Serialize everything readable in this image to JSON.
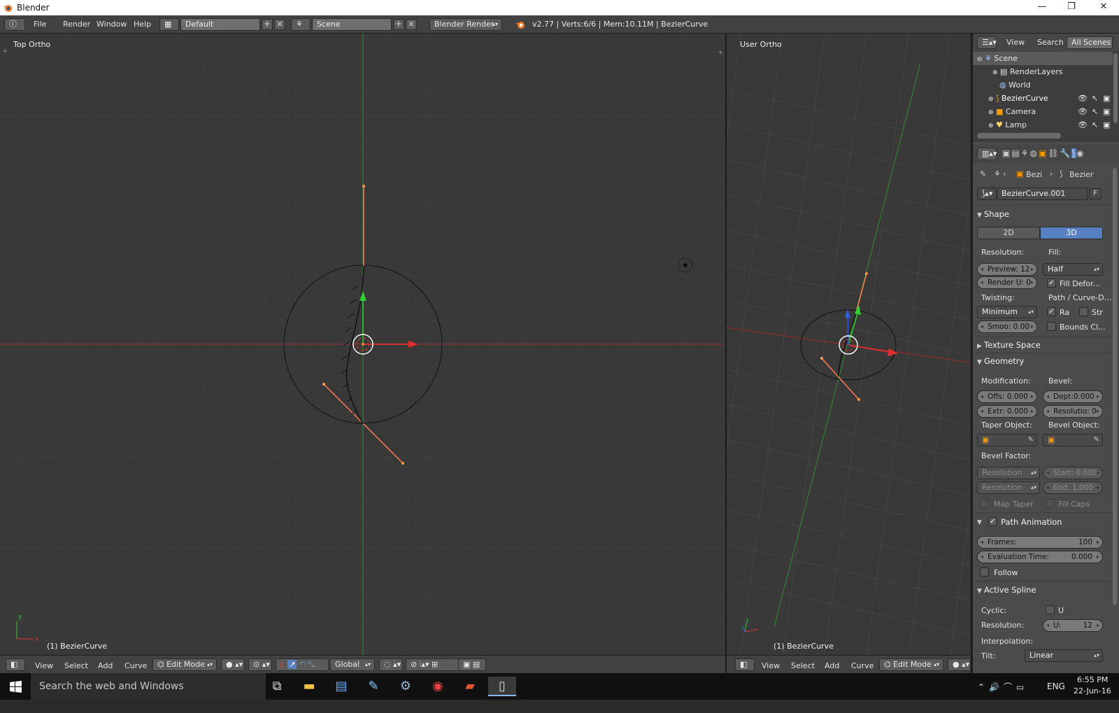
{
  "window": {
    "title": "Blender",
    "minimize_glyph": "—",
    "maximize_glyph": "❐",
    "close_glyph": "✕"
  },
  "infobar": {
    "menus": [
      "File",
      "Render",
      "Window",
      "Help"
    ],
    "layout": "Default",
    "scene": "Scene",
    "engine": "Blender Render",
    "status": "v2.77 | Verts:6/6 | Mem:10.11M | BezierCurve"
  },
  "viewport_left": {
    "label": "Top Ortho",
    "object": "(1) BezierCurve"
  },
  "viewport_right": {
    "label": "User Ortho",
    "object": "(1) BezierCurve"
  },
  "header3d": {
    "menus": [
      "View",
      "Select",
      "Add",
      "Curve"
    ],
    "mode": "Edit Mode",
    "orientation": "Global"
  },
  "outliner": {
    "tabs": [
      "View",
      "Search",
      "All Scenes"
    ],
    "rows": [
      "Scene",
      "RenderLayers",
      "World",
      "BezierCurve",
      "Camera",
      "Lamp"
    ]
  },
  "properties": {
    "breadcrumb": [
      "Bezi",
      "Bezier"
    ],
    "datablock": "BezierCurve.001",
    "fake_user": "F",
    "shape": {
      "title": "Shape",
      "dim_2d": "2D",
      "dim_3d": "3D",
      "resolution_label": "Resolution:",
      "fill_label": "Fill:",
      "preview": "Preview: 12",
      "render_u": "Render U: 0",
      "fill_value": "Half",
      "fill_deform": "Fill Defor...",
      "twisting_label": "Twisting:",
      "path_label": "Path / Curve-D...",
      "twisting_value": "Minimum",
      "radius": "Ra",
      "stretch": "Str",
      "smooth": "Smoo: 0.00",
      "bounds": "Bounds Cl..."
    },
    "texture_space": {
      "title": "Texture Space"
    },
    "geometry": {
      "title": "Geometry",
      "modification_label": "Modification:",
      "bevel_label": "Bevel:",
      "offset": "Offs: 0.000",
      "depth": "Dept:0.000",
      "extrude": "Extr: 0.000",
      "resolution": "Resolutio: 0",
      "taper_label": "Taper Object:",
      "bevel_object_label": "Bevel Object:",
      "bevel_factor_label": "Bevel Factor:",
      "res_mode_1": "Resolution",
      "res_mode_2": "Resolution",
      "start": "Start:  0.000",
      "end": "End:  1.000",
      "map_taper": "Map Taper",
      "fill_caps": "Fill Caps"
    },
    "path_animation": {
      "title": "Path Animation",
      "frames_label": "Frames:",
      "frames_value": "100",
      "eval_label": "Evaluation Time:",
      "eval_value": "0.000",
      "follow": "Follow"
    },
    "active_spline": {
      "title": "Active Spline",
      "cyclic_label": "Cyclic:",
      "cyclic_u": "U",
      "resolution_label": "Resolution:",
      "resolution_u": "U:",
      "resolution_value": "12",
      "interpolation_label": "Interpolation:",
      "tilt_label": "Tilt:",
      "tilt_value": "Linear"
    }
  },
  "taskbar": {
    "search_placeholder": "Search the web and Windows",
    "language": "ENG",
    "time": "6:55 PM",
    "date": "22-Jun-16"
  },
  "colors": {
    "x_axis": "#c0392b",
    "y_axis": "#2f9e2f",
    "handle": "#ff7a4a",
    "selected_3d": "#5680c2"
  }
}
